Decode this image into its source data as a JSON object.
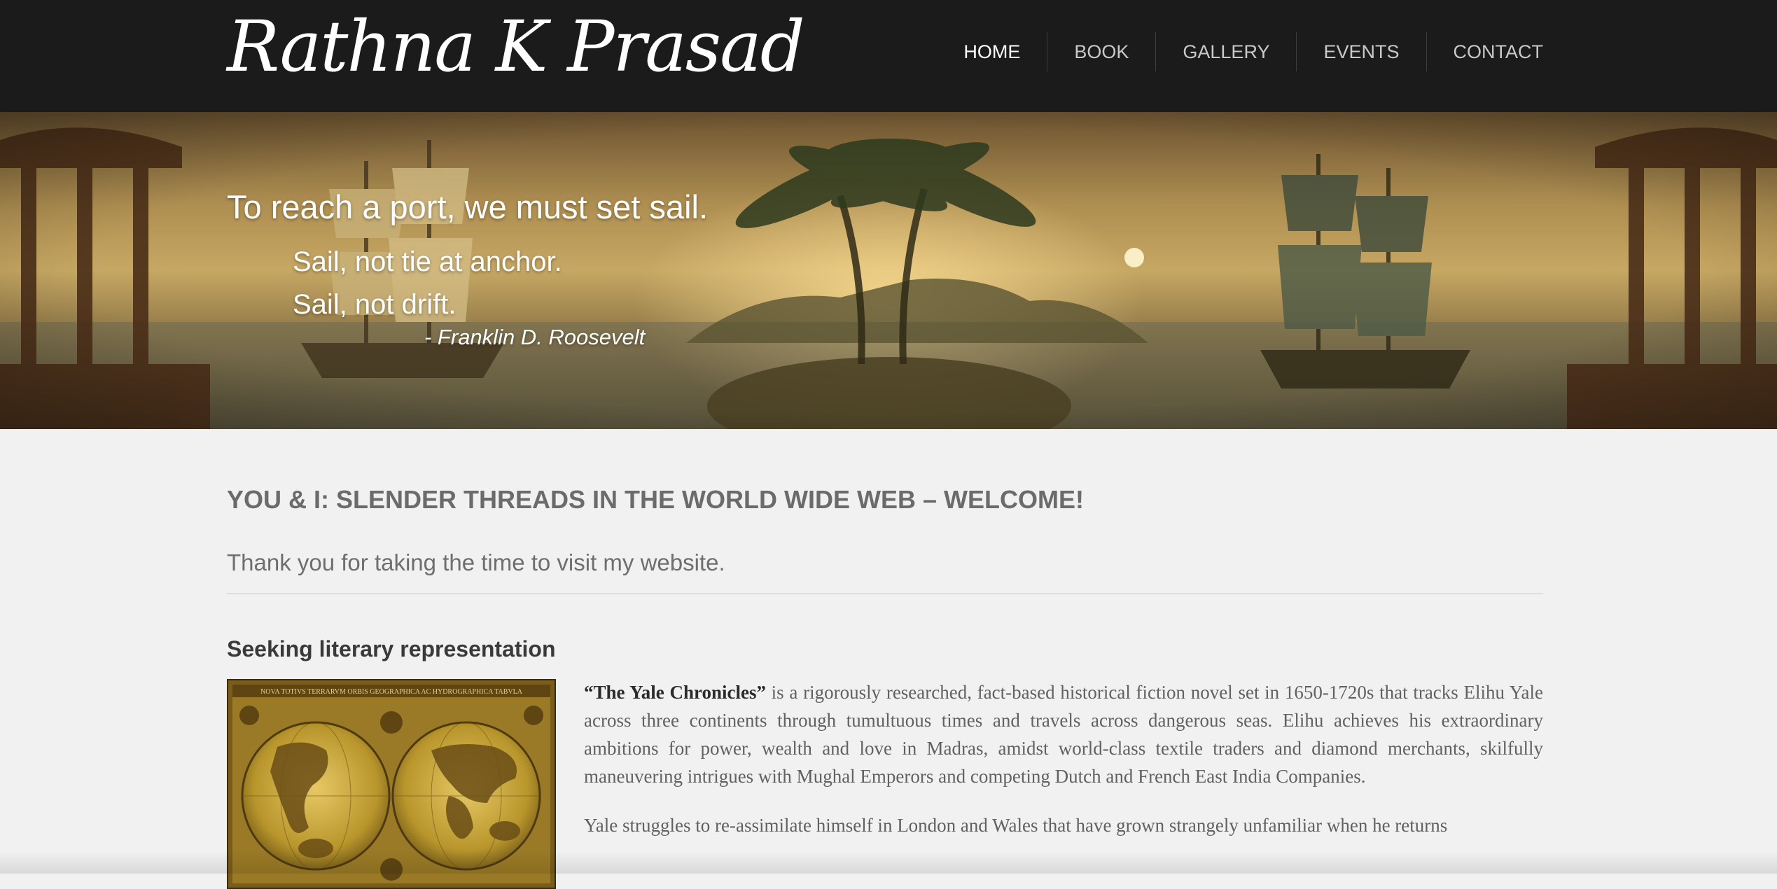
{
  "header": {
    "logo_text": "Rathna K Prasad",
    "nav": [
      {
        "label": "HOME",
        "active": true
      },
      {
        "label": "BOOK",
        "active": false
      },
      {
        "label": "GALLERY",
        "active": false
      },
      {
        "label": "EVENTS",
        "active": false
      },
      {
        "label": "CONTACT",
        "active": false
      }
    ]
  },
  "hero": {
    "quote_line1": "To reach a port, we must set sail.",
    "quote_line2": "Sail, not tie at anchor.",
    "quote_line3": "Sail, not drift.",
    "attribution": "- Franklin D. Roosevelt"
  },
  "main": {
    "welcome_heading": "YOU & I: SLENDER THREADS IN THE WORLD WIDE WEB – WELCOME!",
    "thanks_text": "Thank you for taking the time to visit my website.",
    "section_title": "Seeking literary representation",
    "book_title": "“The Yale Chronicles”",
    "paragraph1_rest": " is a rigorously researched, fact-based historical fiction novel set in 1650-1720s that tracks Elihu Yale across three continents through tumultuous times and travels across dangerous seas. Elihu achieves his extraordinary ambitions for power, wealth and love in Madras, amidst world-class textile traders and diamond merchants, skilfully maneuvering intrigues with Mughal Emperors and competing Dutch and French East India Companies.",
    "paragraph2": "Yale struggles to re-assimilate himself in London and Wales that have grown strangely unfamiliar when he returns",
    "map_caption": "NOVA TOTIVS TERRARVM ORBIS GEOGRAPHICA AC HYDROGRAPHICA TABVLA"
  },
  "colors": {
    "header_bg": "#1b1b1b",
    "page_bg": "#f1f1f1",
    "heading_gray": "#6b6b6b",
    "map_gold": "#b8962c"
  }
}
